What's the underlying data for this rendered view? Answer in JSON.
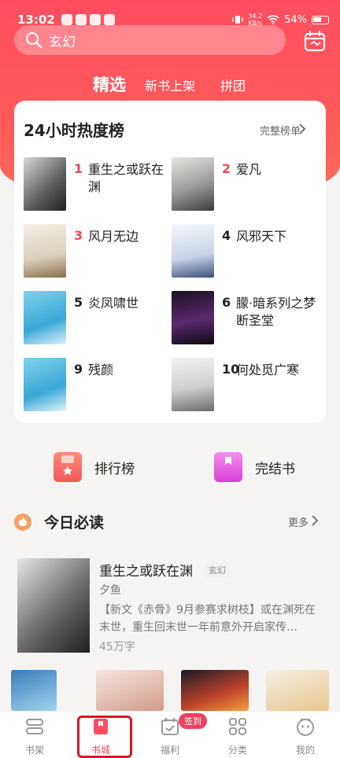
{
  "status_bar": {
    "time": "13:02",
    "speed_top": "34.2",
    "speed_bottom": "KB/s",
    "battery": "54%"
  },
  "search": {
    "placeholder_text": "玄幻"
  },
  "tabs": [
    {
      "label": "精选",
      "active": true
    },
    {
      "label": "新书上架",
      "active": false
    },
    {
      "label": "拼团",
      "active": false
    }
  ],
  "hot_list": {
    "title": "24小时热度榜",
    "more_label": "完整榜单",
    "items": [
      {
        "rank": "1",
        "title": "重生之或跃在渊",
        "rank_color": "red"
      },
      {
        "rank": "2",
        "title": "爱凡",
        "rank_color": "red"
      },
      {
        "rank": "3",
        "title": "风月无边",
        "rank_color": "red"
      },
      {
        "rank": "4",
        "title": "风邪天下",
        "rank_color": "dark"
      },
      {
        "rank": "5",
        "title": "炎凤啸世",
        "rank_color": "dark"
      },
      {
        "rank": "6",
        "title": "朦·暗系列之梦断圣堂",
        "rank_color": "dark"
      },
      {
        "rank": "9",
        "title": "残颜",
        "rank_color": "dark"
      },
      {
        "rank": "10",
        "title": "何处觅广寒",
        "rank_color": "dark"
      }
    ]
  },
  "quick_links": [
    {
      "label": "排行榜",
      "icon": "ranking-icon",
      "color": "#f45a5a"
    },
    {
      "label": "完结书",
      "icon": "book-icon",
      "color": "#e452e0"
    }
  ],
  "today": {
    "title": "今日必读",
    "more_label": "更多",
    "feature": {
      "title": "重生之或跃在渊",
      "tag": "玄幻",
      "author": "夕鱼",
      "description": "【新文《赤骨》9月参赛求树枝】或在渊死在末世，重生回末世一年前意外开启家传…",
      "word_count": "45万字"
    }
  },
  "bottom_nav": [
    {
      "label": "书架",
      "icon": "bookshelf-icon",
      "active": false
    },
    {
      "label": "书城",
      "icon": "bookstore-icon",
      "active": true
    },
    {
      "label": "福利",
      "icon": "calendar-check-icon",
      "active": false,
      "badge": "签到"
    },
    {
      "label": "分类",
      "icon": "grid-icon",
      "active": false
    },
    {
      "label": "我的",
      "icon": "profile-icon",
      "active": false
    }
  ],
  "colors": {
    "brand": "#ff4d5e",
    "active_nav": "#e8495a",
    "highlight_box": "#d3182a"
  }
}
